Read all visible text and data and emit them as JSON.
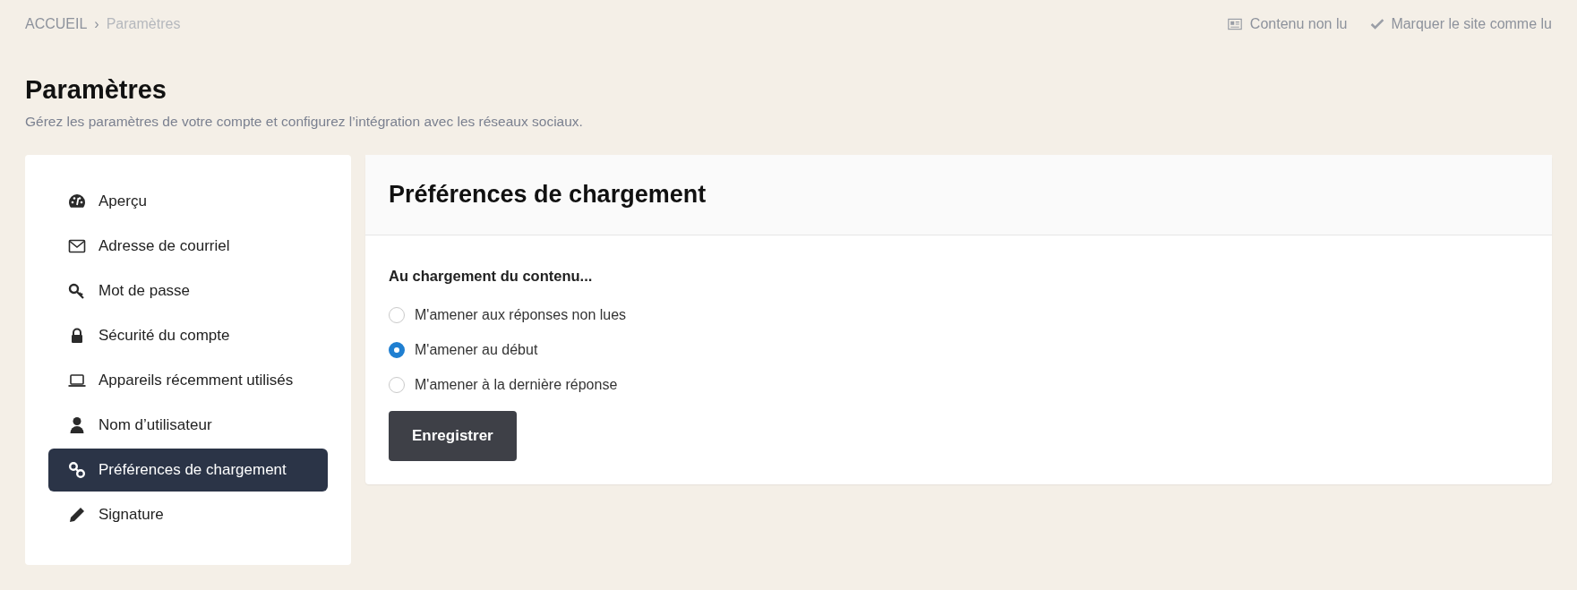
{
  "breadcrumb": {
    "items": [
      "ACCUEIL",
      "Paramètres"
    ],
    "separator": "›"
  },
  "top_links": [
    {
      "label": "Contenu non lu"
    },
    {
      "label": "Marquer le site comme lu"
    }
  ],
  "page": {
    "title": "Paramètres",
    "subtitle": "Gérez les paramètres de votre compte et configurez l’intégration avec les réseaux sociaux."
  },
  "sidebar": {
    "items": [
      {
        "label": "Aperçu",
        "selected": false
      },
      {
        "label": "Adresse de courriel",
        "selected": false
      },
      {
        "label": "Mot de passe",
        "selected": false
      },
      {
        "label": "Sécurité du compte",
        "selected": false
      },
      {
        "label": "Appareils récemment utilisés",
        "selected": false
      },
      {
        "label": "Nom d’utilisateur",
        "selected": false
      },
      {
        "label": "Préférences de chargement",
        "selected": true
      },
      {
        "label": "Signature",
        "selected": false
      }
    ]
  },
  "panel": {
    "title": "Préférences de chargement",
    "group_label": "Au chargement du contenu...",
    "options": [
      {
        "label": "M'amener aux réponses non lues",
        "selected": false
      },
      {
        "label": "M'amener au début",
        "selected": true
      },
      {
        "label": "M'amener à la dernière réponse",
        "selected": false
      }
    ],
    "save_button": "Enregistrer"
  }
}
